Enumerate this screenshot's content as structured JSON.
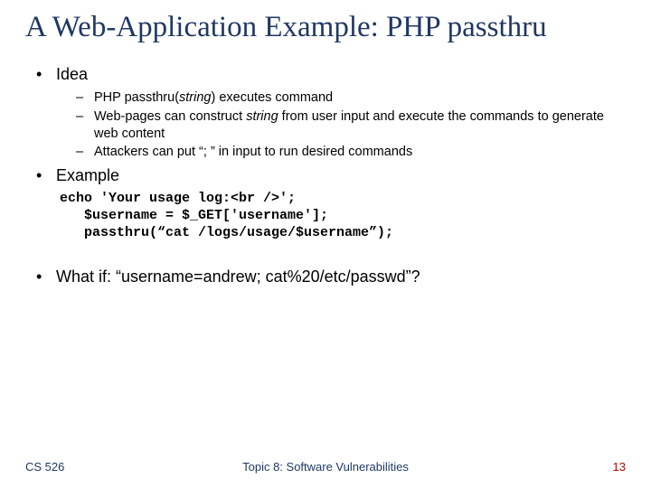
{
  "title": "A Web-Application Example: PHP passthru",
  "bullets": {
    "idea": {
      "label": "Idea",
      "sub": [
        {
          "pre": "PHP passthru(",
          "em": "string",
          "post": ") executes command"
        },
        {
          "pre": "Web-pages can construct ",
          "em": "string",
          "post": " from user input and execute the commands to generate web content"
        },
        {
          "pre": "Attackers can put “; ” in input to run desired commands",
          "em": "",
          "post": ""
        }
      ]
    },
    "example": {
      "label": "Example",
      "code": "echo 'Your usage log:<br />';\n   $username = $_GET['username'];\n   passthru(“cat /logs/usage/$username”);"
    },
    "whatif": {
      "label": "What if: “username=andrew; cat%20/etc/passwd”?"
    }
  },
  "footer": {
    "left": "CS 526",
    "center": "Topic 8: Software Vulnerabilities",
    "right": "13"
  }
}
